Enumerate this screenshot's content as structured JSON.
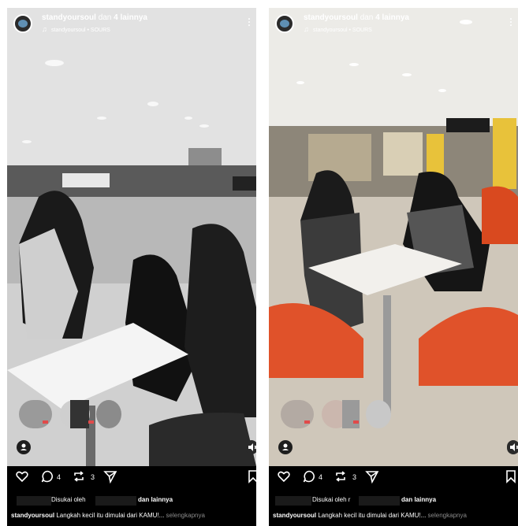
{
  "posts": [
    {
      "username": "standyoursoul",
      "username_suffix": "dan",
      "collab_label": "4 lainnya",
      "music": "standyoursoul • SOURS",
      "comment_count": "4",
      "repost_count": "3",
      "liked_by_prefix": "Disukai oleh",
      "liked_by_suffix": "dan lainnya",
      "caption_user": "standyoursoul",
      "caption_text": "Langkah kecil itu dimulai dari KAMU!...",
      "caption_more": "selengkapnya"
    },
    {
      "username": "standyoursoul",
      "username_suffix": "dan",
      "collab_label": "4 lainnya",
      "music": "standyoursoul • SOURS",
      "comment_count": "4",
      "repost_count": "3",
      "liked_by_prefix": "Disukai oleh r",
      "liked_by_suffix": "dan lainnya",
      "caption_user": "standyoursoul",
      "caption_text": "Langkah kecil itu dimulai dari KAMU!...",
      "caption_more": "selengkapnya"
    }
  ],
  "icons": {
    "like": "heart-icon",
    "comment": "comment-icon",
    "repost": "repost-icon",
    "share": "send-icon",
    "save": "bookmark-icon",
    "music": "music-note-icon",
    "more": "more-vertical-icon",
    "tag": "user-tag-icon",
    "mute": "speaker-mute-icon"
  },
  "colors": {
    "background": "#000000",
    "text": "#ffffff",
    "muted": "#8a8a8a",
    "chair_orange": "#e0522a"
  }
}
